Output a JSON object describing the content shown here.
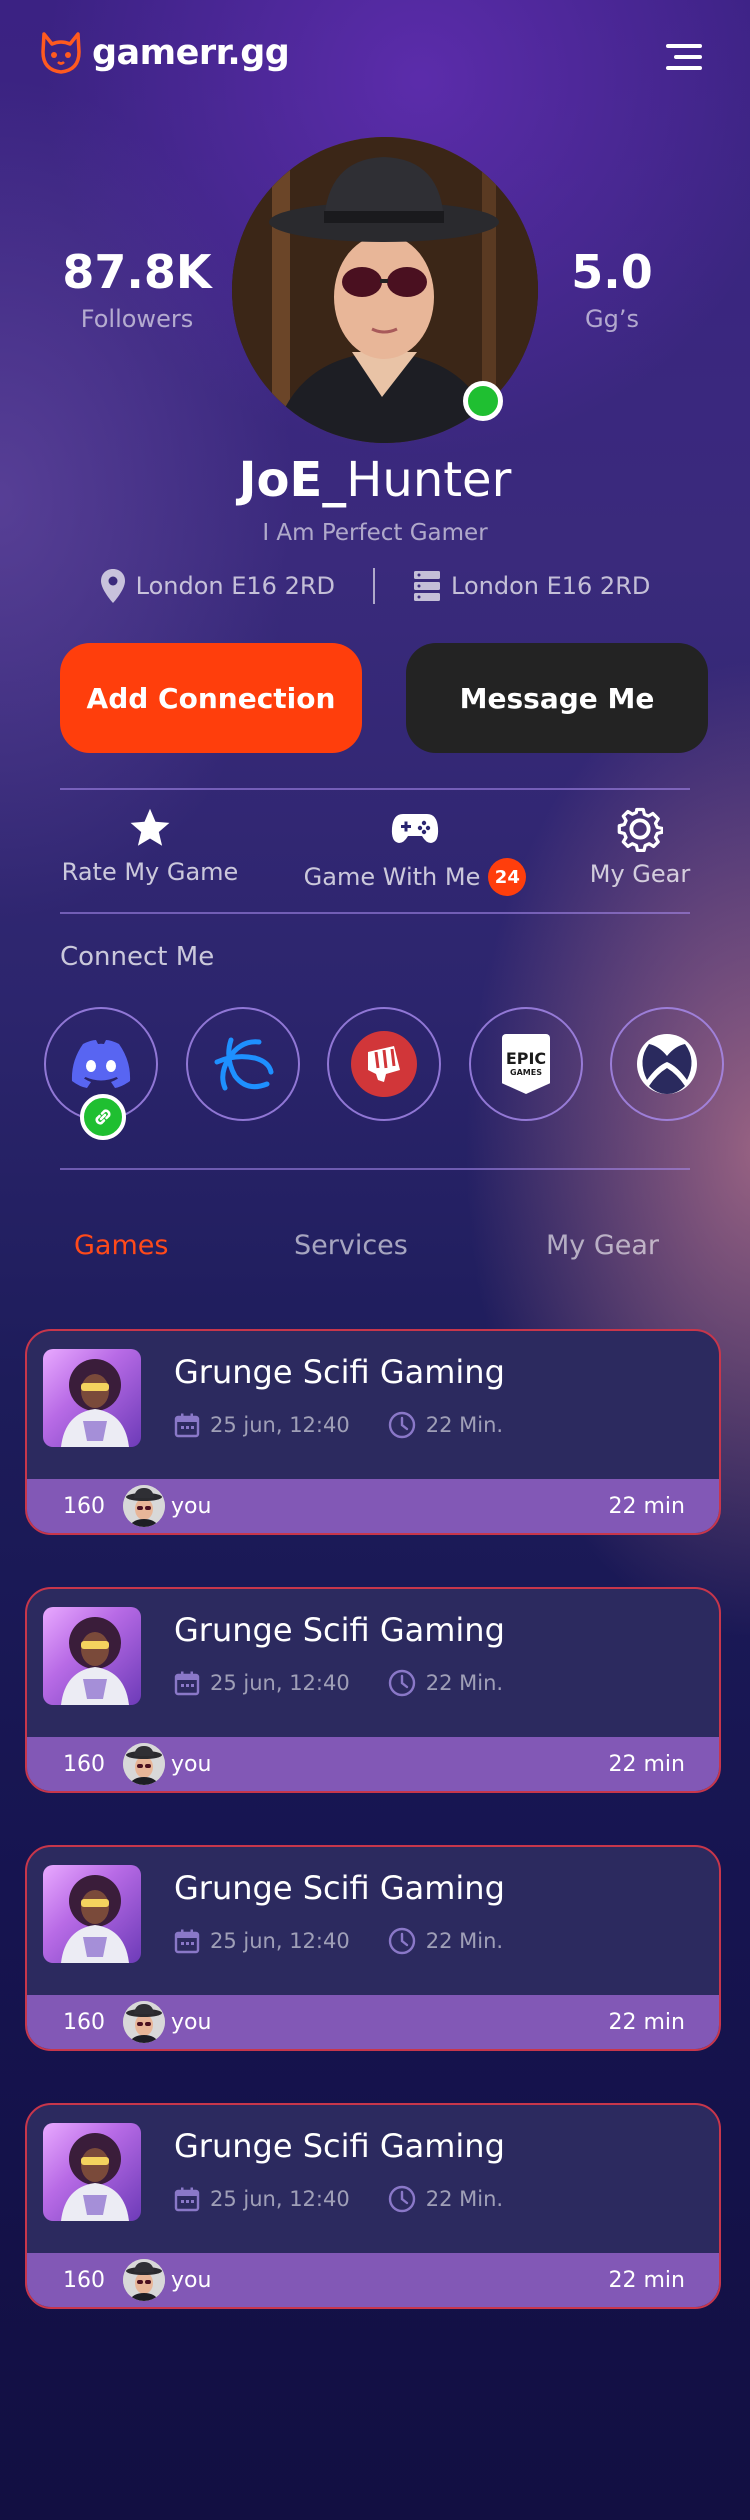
{
  "header": {
    "brand": "gamerr.gg",
    "logo_icon": "cat-icon",
    "menu_icon": "menu-icon"
  },
  "profile": {
    "followers_value": "87.8K",
    "followers_label": "Followers",
    "rating_value": "5.0",
    "rating_label": "Gg’s",
    "username_bold": "JoE_",
    "username_rest": "Hunter",
    "tagline": "I Am Perfect Gamer",
    "location_1": "London E16 2RD",
    "location_2": "London E16 2RD",
    "online": true
  },
  "buttons": {
    "add_connection": "Add Connection",
    "message_me": "Message Me"
  },
  "actions": [
    {
      "label": "Rate My Game",
      "icon": "star-icon"
    },
    {
      "label": "Game With Me",
      "icon": "gamepad-icon",
      "badge": "24"
    },
    {
      "label": "My Gear",
      "icon": "gear-icon"
    }
  ],
  "connect": {
    "title": "Connect Me",
    "platforms": [
      "discord-icon",
      "battlenet-icon",
      "riot-icon",
      "epic-games-icon",
      "xbox-icon"
    ],
    "epic_logo_text": "EPIC",
    "epic_logo_sub": "GAMES"
  },
  "tabs": [
    {
      "label": "Games",
      "active": true
    },
    {
      "label": "Services",
      "active": false
    },
    {
      "label": "My Gear",
      "active": false
    }
  ],
  "games": [
    {
      "title": "Grunge Scifi Gaming",
      "date": "25 jun, 12:40",
      "duration": "22 Min.",
      "count": "160",
      "user": "you",
      "time": "22 min"
    },
    {
      "title": "Grunge Scifi Gaming",
      "date": "25 jun, 12:40",
      "duration": "22 Min.",
      "count": "160",
      "user": "you",
      "time": "22 min"
    },
    {
      "title": "Grunge Scifi Gaming",
      "date": "25 jun, 12:40",
      "duration": "22 Min.",
      "count": "160",
      "user": "you",
      "time": "22 min"
    },
    {
      "title": "Grunge Scifi Gaming",
      "date": "25 jun, 12:40",
      "duration": "22 Min.",
      "count": "160",
      "user": "you",
      "time": "22 min"
    }
  ],
  "colors": {
    "accent": "#ff3e0c",
    "online": "#1fbf31",
    "card_border": "#c8364b",
    "card_footer": "#8258b6"
  }
}
